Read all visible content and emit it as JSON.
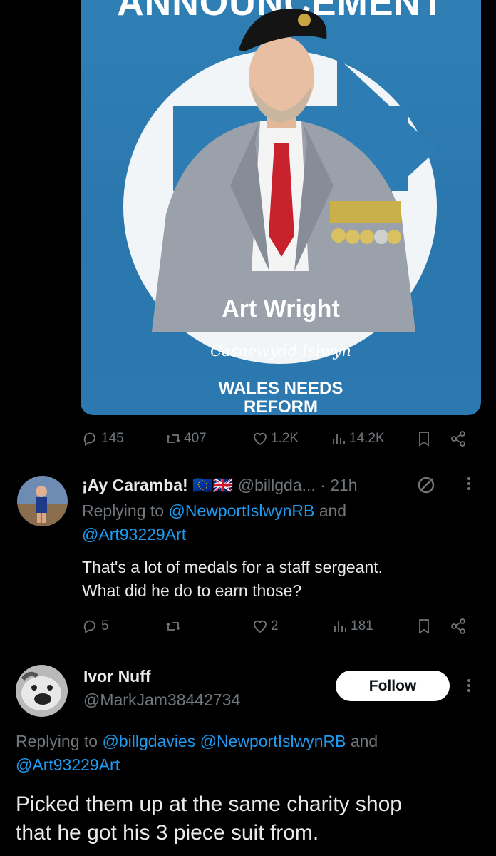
{
  "post": {
    "image": {
      "headline": "ANNOUNCEMENT",
      "candidate_name": "Art Wright",
      "constituency": "Casnewydd Islwyn",
      "slogan_line1": "WALES NEEDS",
      "slogan_line2": "REFORM",
      "background_color": "#2d7db4"
    },
    "stats": {
      "replies": "145",
      "reposts": "407",
      "likes": "1.2K",
      "views": "14.2K"
    }
  },
  "reply1": {
    "display_name": "¡Ay Caramba!",
    "flags": "🇪🇺🇬🇧",
    "handle": "@billgda...",
    "time": "· 21h",
    "replying_prefix": "Replying to",
    "replying_to_1": "@NewportIslwynRB",
    "replying_and": "and",
    "replying_to_2": "@Art93229Art",
    "text_line1": "That's a lot of medals for a staff sergeant.",
    "text_line2": "What did he do to earn those?",
    "stats": {
      "replies": "5",
      "reposts": "",
      "likes": "2",
      "views": "181"
    }
  },
  "reply2": {
    "display_name": "Ivor Nuff",
    "handle": "@MarkJam38442734",
    "follow_label": "Follow",
    "replying_prefix": "Replying to",
    "replying_to_1": "@billgdavies",
    "replying_to_2": "@NewportIslwynRB",
    "replying_and": "and",
    "replying_to_3": "@Art93229Art",
    "text_line1": "Picked them up at the same charity shop",
    "text_line2": "that he got his 3 piece suit from."
  },
  "colors": {
    "background": "#000000",
    "text": "#e7e9ea",
    "muted": "#71767b",
    "link": "#1d9bf0"
  }
}
